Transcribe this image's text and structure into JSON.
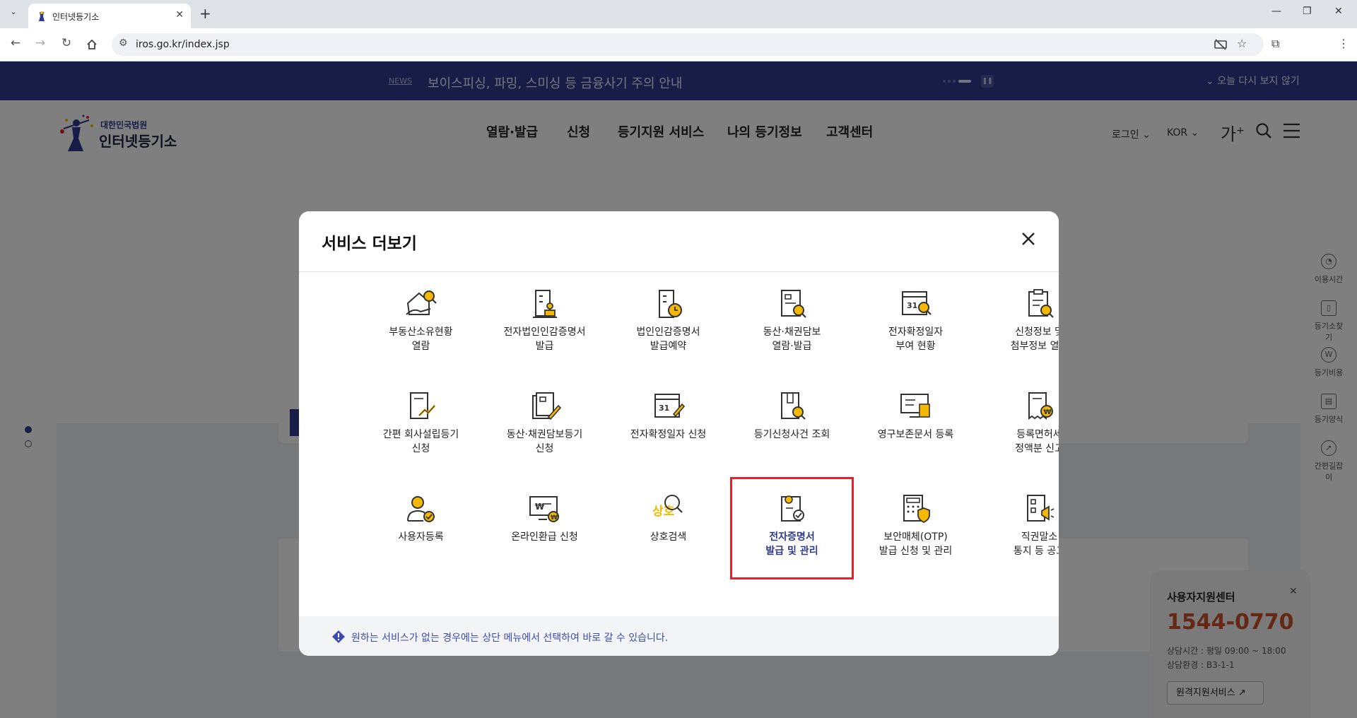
{
  "browser": {
    "tab_title": "인터넷등기소",
    "url": "iros.go.kr/index.jsp"
  },
  "news": {
    "tag": "NEWS",
    "headline": "보이스피싱, 파밍, 스미싱 등 금융사기 주의 안내",
    "dismiss": "오늘 다시 보지 않기"
  },
  "header": {
    "logo_small": "대한민국법원",
    "logo_big": "인터넷등기소",
    "menu": [
      "열람·발급",
      "신청",
      "등기지원 서비스",
      "나의 등기정보",
      "고객센터"
    ],
    "login": "로그인",
    "language": "KOR",
    "font_size_icon": "가"
  },
  "quick_menu": [
    "이용시간",
    "등기소찾기",
    "등기비용",
    "등기양식",
    "간편길잡이"
  ],
  "help_center": {
    "title": "사용자지원센터",
    "phone": "1544-0770",
    "hours": "상담시간 : 평일 09:00 ~ 18:00",
    "env": "상담환경 : B3-1-1",
    "remote_button": "원격지원서비스"
  },
  "modal": {
    "title": "서비스 더보기",
    "items": [
      {
        "label": "부동산소유현황\n열람",
        "icon": "house-search-icon"
      },
      {
        "label": "전자법인인감증명서\n발급",
        "icon": "building-stamp-icon"
      },
      {
        "label": "법인인감증명서\n발급예약",
        "icon": "building-clock-icon"
      },
      {
        "label": "동산·채권담보\n열람·발급",
        "icon": "document-search-icon"
      },
      {
        "label": "전자확정일자\n부여 현황",
        "icon": "calendar-search-icon"
      },
      {
        "label": "신청정보 및\n첨부정보 열람",
        "icon": "clipboard-search-icon"
      },
      {
        "label": "간편 회사설립등기\n신청",
        "icon": "document-chart-icon"
      },
      {
        "label": "동산·채권담보등기\n신청",
        "icon": "documents-pen-icon"
      },
      {
        "label": "전자확정일자 신청",
        "icon": "calendar-pen-icon"
      },
      {
        "label": "등기신청사건 조회",
        "icon": "book-search-icon"
      },
      {
        "label": "영구보존문서 등록",
        "icon": "monitor-document-icon"
      },
      {
        "label": "등록면허세\n정액분 신고",
        "icon": "receipt-won-icon"
      },
      {
        "label": "사용자등록",
        "icon": "user-check-icon"
      },
      {
        "label": "온라인환급 신청",
        "icon": "monitor-won-icon"
      },
      {
        "label": "상호검색",
        "icon": "trade-name-search-icon",
        "icon_text": "상호"
      },
      {
        "label": "전자증명서\n발급 및 관리",
        "icon": "certificate-check-icon",
        "active": true
      },
      {
        "label": "보안매체(OTP)\n발급 신청 및 관리",
        "icon": "calculator-shield-icon"
      },
      {
        "label": "직권말소\n통지 등 공고",
        "icon": "document-megaphone-icon"
      }
    ],
    "footer_text": "원하는 서비스가 없는 경우에는 상단 메뉴에서 선택하여 바로 갈 수 있습니다."
  },
  "colors": {
    "brand_navy": "#2f3a8c",
    "accent_yellow": "#f5b800",
    "highlight_red": "#e8202a",
    "phone_orange": "#c8502a"
  }
}
